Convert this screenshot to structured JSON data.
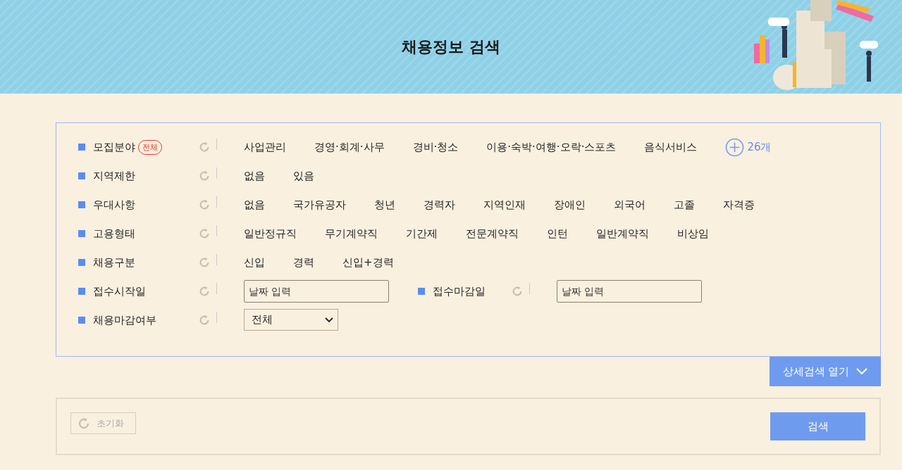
{
  "header": {
    "title": "채용정보 검색"
  },
  "filters": [
    {
      "kind": "options",
      "label": "모집분야",
      "badge": "전체",
      "options": [
        "사업관리",
        "경영·회계·사무",
        "경비·청소",
        "이용·숙박·여행·오락·스포츠",
        "음식서비스"
      ],
      "more": "26개"
    },
    {
      "kind": "options",
      "label": "지역제한",
      "options": [
        "없음",
        "있음"
      ]
    },
    {
      "kind": "options",
      "label": "우대사항",
      "options": [
        "없음",
        "국가유공자",
        "청년",
        "경력자",
        "지역인재",
        "장애인",
        "외국어",
        "고졸",
        "자격증"
      ]
    },
    {
      "kind": "options",
      "label": "고용형태",
      "options": [
        "일반정규직",
        "무기계약직",
        "기간제",
        "전문계약직",
        "인턴",
        "일반계약직",
        "비상임"
      ]
    },
    {
      "kind": "options",
      "label": "채용구분",
      "options": [
        "신입",
        "경력",
        "신입+경력"
      ]
    },
    {
      "kind": "dates",
      "label": "접수시작일",
      "placeholder": "날짜 입력",
      "second_label": "접수마감일",
      "second_placeholder": "날짜 입력"
    },
    {
      "kind": "select",
      "label": "채용마감여부",
      "value": "전체"
    }
  ],
  "detail_button": "상세검색 열기",
  "reset_button": {
    "label": "초기화",
    "disabled": true
  },
  "search_button": "검색"
}
